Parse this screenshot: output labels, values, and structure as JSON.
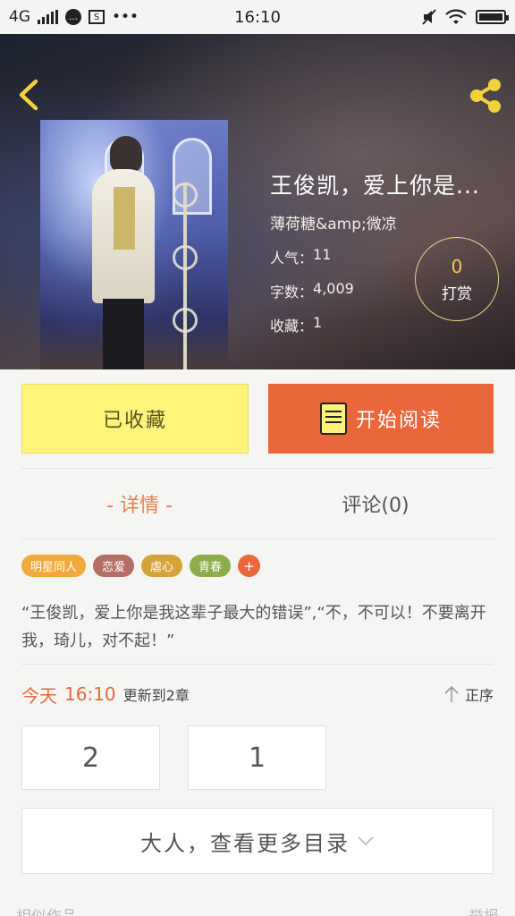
{
  "status_bar": {
    "network": "4G",
    "time": "16:10"
  },
  "book": {
    "title": "王俊凯，爱上你是...",
    "author": "薄荷糖&amp;微凉",
    "popularity_label": "人气：",
    "popularity_value": "11",
    "words_label": "字数：",
    "words_value": "4,009",
    "favorites_label": "收藏：",
    "favorites_value": "1"
  },
  "reward": {
    "count": "0",
    "label": "打赏"
  },
  "actions": {
    "collected_label": "已收藏",
    "read_label": "开始阅读"
  },
  "tabs": {
    "details_label": "- 详情 -",
    "comments_label": "评论(0)"
  },
  "tags": [
    {
      "label": "明星同人",
      "color": "#efa93c"
    },
    {
      "label": "恋爱",
      "color": "#b46e63"
    },
    {
      "label": "虐心",
      "color": "#d4a43b"
    },
    {
      "label": "青春",
      "color": "#8dac4b"
    }
  ],
  "tag_add": "+",
  "summary": "“王俊凯，爱上你是我这辈子最大的错误”,“不，不可以！不要离开我，琦儿，对不起！”",
  "update": {
    "day": "今天",
    "time": "16:10",
    "text": "更新到2章",
    "sort_label": "正序"
  },
  "chapters": [
    "2",
    "1"
  ],
  "more_catalog_label": "大人，查看更多目录",
  "footer": {
    "left": "相似作品",
    "right": "举报"
  },
  "colors": {
    "accent_orange": "#e9673a",
    "collected_yellow": "#fdf47a",
    "tab_active": "#e9804d",
    "icon_yellow": "#f2d23a"
  }
}
